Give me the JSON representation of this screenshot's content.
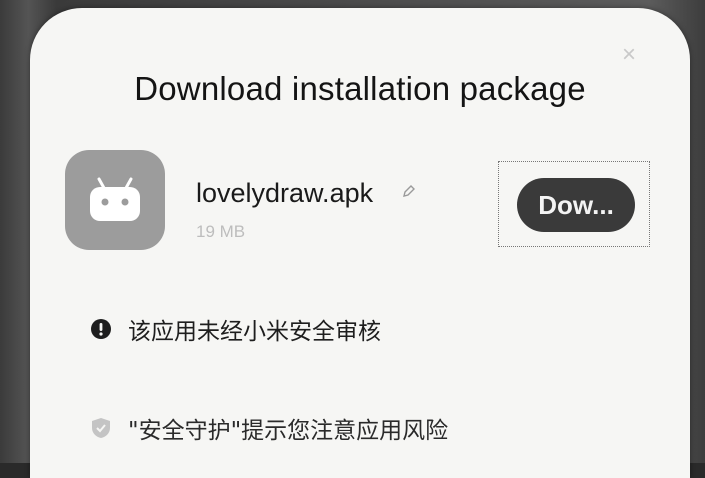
{
  "dialog": {
    "title": "Download installation package",
    "close_symbol": "×"
  },
  "app": {
    "icon": "android-icon",
    "file_name": "lovelydraw.apk",
    "file_size": "19 MB",
    "download_label": "Dow..."
  },
  "notices": [
    {
      "icon": "exclamation-circle-icon",
      "text": "该应用未经小米安全审核"
    },
    {
      "icon": "shield-icon",
      "text": "\"安全守护\"提示您注意应用风险"
    }
  ],
  "colors": {
    "button": "#3a3a3a",
    "dialog_bg": "#f6f6f4",
    "icon_bg": "#9c9c9c"
  }
}
